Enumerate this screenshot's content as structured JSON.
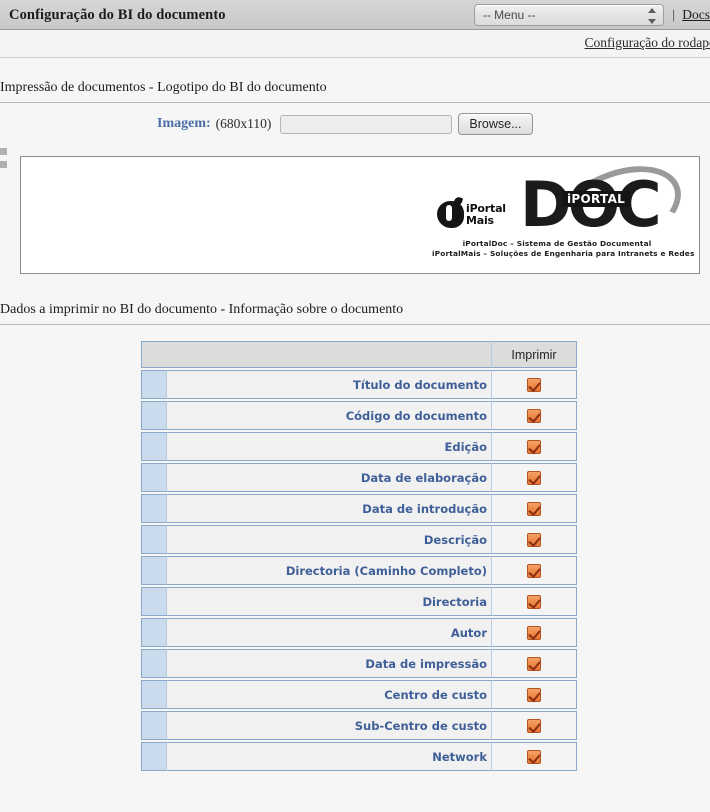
{
  "titlebar": {
    "title": "Configuração do BI do documento",
    "menu_select_value": "-- Menu --",
    "separator": "|",
    "docs_link": "Docs"
  },
  "subbar": {
    "footer_config_link": "Configuração do rodapé"
  },
  "logo_section": {
    "title": "Impressão de documentos - Logotipo do BI do documento",
    "upload": {
      "label": "Imagem:",
      "dimensions": "(680x110)",
      "file_value": "",
      "file_placeholder": "",
      "browse_label": "Browse..."
    },
    "logo": {
      "brand_left_line1": "iPortal",
      "brand_left_line2": "Mais",
      "brand_main": "DOC",
      "badge": "iPORTAL",
      "tagline_line1": "iPortalDoc – Sistema de Gestão Documental",
      "tagline_line2": "iPortalMais – Soluções de Engenharia para Intranets e Redes"
    }
  },
  "data_section": {
    "title": "Dados a imprimir no BI do documento - Informação sobre o documento",
    "columns": {
      "spacer": "",
      "field": "",
      "print": "Imprimir"
    },
    "rows": [
      {
        "label": "Título do documento",
        "checked": true
      },
      {
        "label": "Código do documento",
        "checked": true
      },
      {
        "label": "Edição",
        "checked": true
      },
      {
        "label": "Data de elaboração",
        "checked": true
      },
      {
        "label": "Data de introdução",
        "checked": true
      },
      {
        "label": "Descrição",
        "checked": true
      },
      {
        "label": "Directoria (Caminho Completo)",
        "checked": true
      },
      {
        "label": "Directoria",
        "checked": true
      },
      {
        "label": "Autor",
        "checked": true
      },
      {
        "label": "Data de impressão",
        "checked": true
      },
      {
        "label": "Centro de custo",
        "checked": true
      },
      {
        "label": "Sub-Centro de custo",
        "checked": true
      },
      {
        "label": "Network",
        "checked": true
      }
    ]
  },
  "colors": {
    "label_blue": "#3f5f98",
    "accent_blue": "#4a6ea8",
    "checkbox_orange": "#ef8a48",
    "row_left_blue": "#c9dbed",
    "border_blue": "#8aa9c9"
  }
}
